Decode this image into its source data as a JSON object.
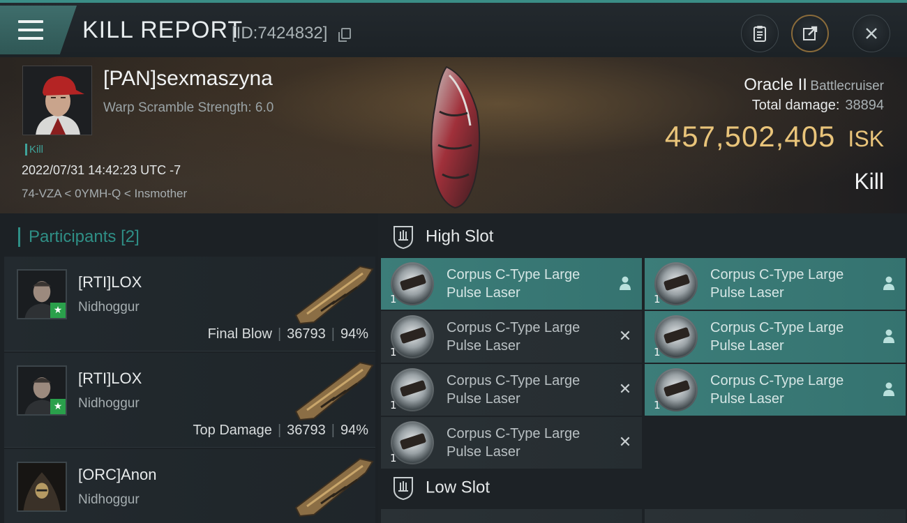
{
  "header": {
    "title": "KILL REPORT",
    "id_text": "[ID:7424832]"
  },
  "victim": {
    "name": "[PAN]sexmaszyna",
    "warp_scramble": "Warp Scramble Strength: 6.0",
    "tag": "Kill",
    "datetime": "2022/07/31 14:42:23 UTC -7",
    "location": "74-VZA < 0YMH-Q < Insmother",
    "ship_name": "Oracle II",
    "ship_class": "Battlecruiser",
    "total_damage_label": "Total damage:",
    "total_damage": "38894",
    "isk_value": "457,502,405",
    "isk_unit": "ISK",
    "result": "Kill"
  },
  "participants": {
    "label": "Participants",
    "count": "[2]",
    "rows": [
      {
        "name": "[RTI]LOX",
        "ship": "Nidhoggur",
        "role": "Final Blow",
        "damage": "36793",
        "percent": "94%"
      },
      {
        "name": "[RTI]LOX",
        "ship": "Nidhoggur",
        "role": "Top Damage",
        "damage": "36793",
        "percent": "94%"
      },
      {
        "name": "[ORC]Anon",
        "ship": "Nidhoggur",
        "role": "",
        "damage": "",
        "percent": ""
      }
    ],
    "separator": "|"
  },
  "slots": {
    "high_slot_label": "High Slot",
    "low_slot_label": "Low Slot",
    "items": [
      {
        "name": "Corpus C-Type Large Pulse Laser",
        "qty": "1",
        "state": "dropped"
      },
      {
        "name": "Corpus C-Type Large Pulse Laser",
        "qty": "1",
        "state": "dropped"
      },
      {
        "name": "Corpus C-Type Large Pulse Laser",
        "qty": "1",
        "state": "destroyed"
      },
      {
        "name": "Corpus C-Type Large Pulse Laser",
        "qty": "1",
        "state": "dropped"
      },
      {
        "name": "Corpus C-Type Large Pulse Laser",
        "qty": "1",
        "state": "destroyed"
      },
      {
        "name": "Corpus C-Type Large Pulse Laser",
        "qty": "1",
        "state": "dropped"
      },
      {
        "name": "Corpus C-Type Large Pulse Laser",
        "qty": "1",
        "state": "destroyed"
      }
    ],
    "destroyed_glyph": "✕"
  }
}
